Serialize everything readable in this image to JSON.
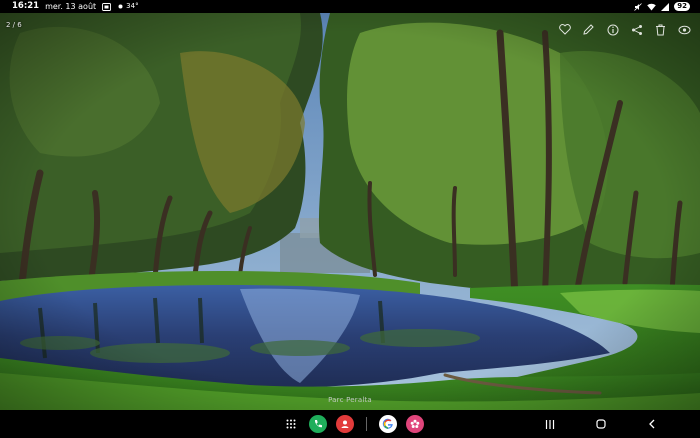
{
  "status_bar": {
    "time": "16:21",
    "date": "mer. 13 août",
    "temperature": "34°",
    "battery": "92"
  },
  "viewer": {
    "counter": "2 / 6",
    "location": "Parc Peralta",
    "toolbar": [
      "heart-icon",
      "edit-icon",
      "info-icon",
      "share-icon",
      "delete-icon",
      "more-icon"
    ]
  },
  "dock": {
    "apps": [
      "phone-app",
      "contacts-app",
      "google-app",
      "gallery-app"
    ]
  },
  "colors": {
    "phone": "#1fae5b",
    "contacts": "#e23b3b",
    "gallery": "#e0457b",
    "google_blue": "#4285f4"
  }
}
